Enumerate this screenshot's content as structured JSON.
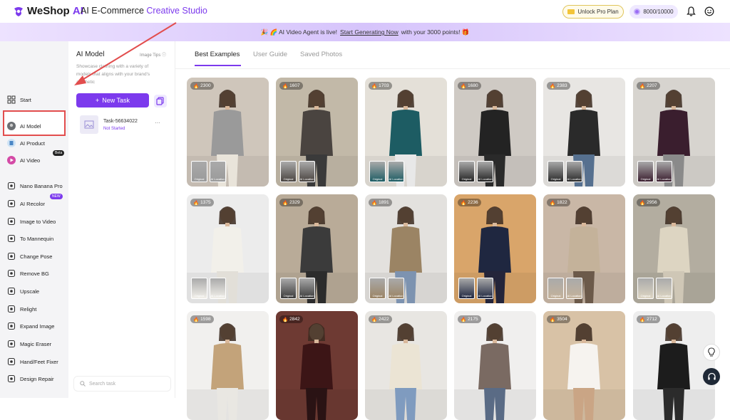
{
  "header": {
    "logo_prefix": "WeShop",
    "logo_suffix": "AI",
    "title_prefix": "AI E-Commerce ",
    "title_highlight": "Creative Studio",
    "pro_label": "Unlock Pro Plan",
    "credits": "8000/10000"
  },
  "banner": {
    "prefix": "🎉 🌈 AI Video Agent is live!",
    "link": "Start Generating Now",
    "suffix": "with your 3000 points! 🎁"
  },
  "sidebar": {
    "items": [
      {
        "label": "Start",
        "icon": "grid-icon"
      },
      {
        "label": "AI Model",
        "icon": "avatar-icon"
      },
      {
        "label": "AI Product",
        "icon": "product-icon"
      },
      {
        "label": "AI Video",
        "icon": "video-icon",
        "badge": "Beta"
      },
      {
        "label": "Nano Banana Pro",
        "icon": "banana-icon"
      },
      {
        "label": "AI Recolor",
        "icon": "palette-icon",
        "badge": "NEW"
      },
      {
        "label": "Image to Video",
        "icon": "film-icon"
      },
      {
        "label": "To Mannequin",
        "icon": "mannequin-icon"
      },
      {
        "label": "Change Pose",
        "icon": "pose-icon"
      },
      {
        "label": "Remove BG",
        "icon": "remove-bg-icon"
      },
      {
        "label": "Upscale",
        "icon": "upscale-icon"
      },
      {
        "label": "Relight",
        "icon": "relight-icon"
      },
      {
        "label": "Expand Image",
        "icon": "expand-icon"
      },
      {
        "label": "Magic Eraser",
        "icon": "eraser-icon"
      },
      {
        "label": "Hand/Feet Fixer",
        "icon": "hand-icon"
      },
      {
        "label": "Design Repair",
        "icon": "repair-icon"
      }
    ]
  },
  "panel": {
    "title": "AI Model",
    "tips": "Image Tips",
    "desc_top": "Showcase clothing with a variety of",
    "desc_mid": "models that aligns with your brand's",
    "desc_bot": "aesthetic",
    "new_task": "New Task",
    "task_name": "Task-56634022",
    "task_status": "Not Started",
    "search_placeholder": "Search task"
  },
  "tabs": [
    "Best Examples",
    "User Guide",
    "Saved Photos"
  ],
  "gallery": [
    {
      "count": "2300",
      "bg": "#cfc6bb",
      "outfit": "#9a9a9a",
      "pants": "#e9e4da",
      "orig": "Original",
      "loc": "AI Location"
    },
    {
      "count": "1607",
      "bg": "#c2b9a8",
      "outfit": "#4a4440",
      "pants": "#3a3a3a",
      "orig": "Original",
      "loc": "AI Location"
    },
    {
      "count": "1703",
      "bg": "#e4e0d8",
      "outfit": "#1d5c63",
      "pants": "#e8e8e8",
      "orig": "Original",
      "loc": "AI Location"
    },
    {
      "count": "1680",
      "bg": "#cfcac4",
      "outfit": "#232323",
      "pants": "#2a2a2a",
      "orig": "Original",
      "loc": "AI Location"
    },
    {
      "count": "2383",
      "bg": "#e8e6e3",
      "outfit": "#2a2a2a",
      "pants": "#56708f",
      "orig": "Original",
      "loc": "AI Location"
    },
    {
      "count": "2207",
      "bg": "#d7d4cf",
      "outfit": "#3a1e2e",
      "pants": "#8a8a8a",
      "orig": "Original",
      "loc": "AI Location"
    },
    {
      "count": "1375",
      "bg": "#ececec",
      "outfit": "#f2f0ea",
      "pants": "#e2dfd8",
      "orig": "Original",
      "loc": "AI Location"
    },
    {
      "count": "2329",
      "bg": "#b9ab98",
      "outfit": "#3b3b3b",
      "pants": "#2c2c2c",
      "orig": "Original",
      "loc": "AI Location"
    },
    {
      "count": "1891",
      "bg": "#e3e1de",
      "outfit": "#9b8464",
      "pants": "#7d93b0",
      "orig": "Original",
      "loc": "AI Location"
    },
    {
      "count": "2236",
      "bg": "#d9a56a",
      "outfit": "#1f2740",
      "pants": "#24253a",
      "orig": "Original",
      "loc": "AI Location"
    },
    {
      "count": "1822",
      "bg": "#c9b7a6",
      "outfit": "#c4b29a",
      "pants": "#6c5a4a",
      "orig": "Original",
      "loc": "AI Location"
    },
    {
      "count": "2956",
      "bg": "#b3ada0",
      "outfit": "#ddd5c2",
      "pants": "#cfc7b6",
      "orig": "Original",
      "loc": "AI Location"
    },
    {
      "count": "1598",
      "bg": "#f1f0ee",
      "outfit": "#c3a37a",
      "pants": "#e9e7e2",
      "orig": "",
      "loc": ""
    },
    {
      "count": "2842",
      "bg": "#6e3a33",
      "outfit": "#3c1516",
      "pants": "#2a1314",
      "orig": "",
      "loc": ""
    },
    {
      "count": "2422",
      "bg": "#e8e6e2",
      "outfit": "#ebe4d4",
      "pants": "#7f9bbf",
      "orig": "",
      "loc": ""
    },
    {
      "count": "2175",
      "bg": "#f0efee",
      "outfit": "#7a6a62",
      "pants": "#5a6b85",
      "orig": "",
      "loc": ""
    },
    {
      "count": "3504",
      "bg": "#d8c2a6",
      "outfit": "#f6f3ef",
      "pants": "#caa585",
      "orig": "",
      "loc": ""
    },
    {
      "count": "2712",
      "bg": "#eeeeee",
      "outfit": "#1c1c1c",
      "pants": "#2b2b2b",
      "orig": "",
      "loc": ""
    }
  ],
  "colors": {
    "accent": "#7c3aed",
    "annotation": "#e24d4d"
  }
}
